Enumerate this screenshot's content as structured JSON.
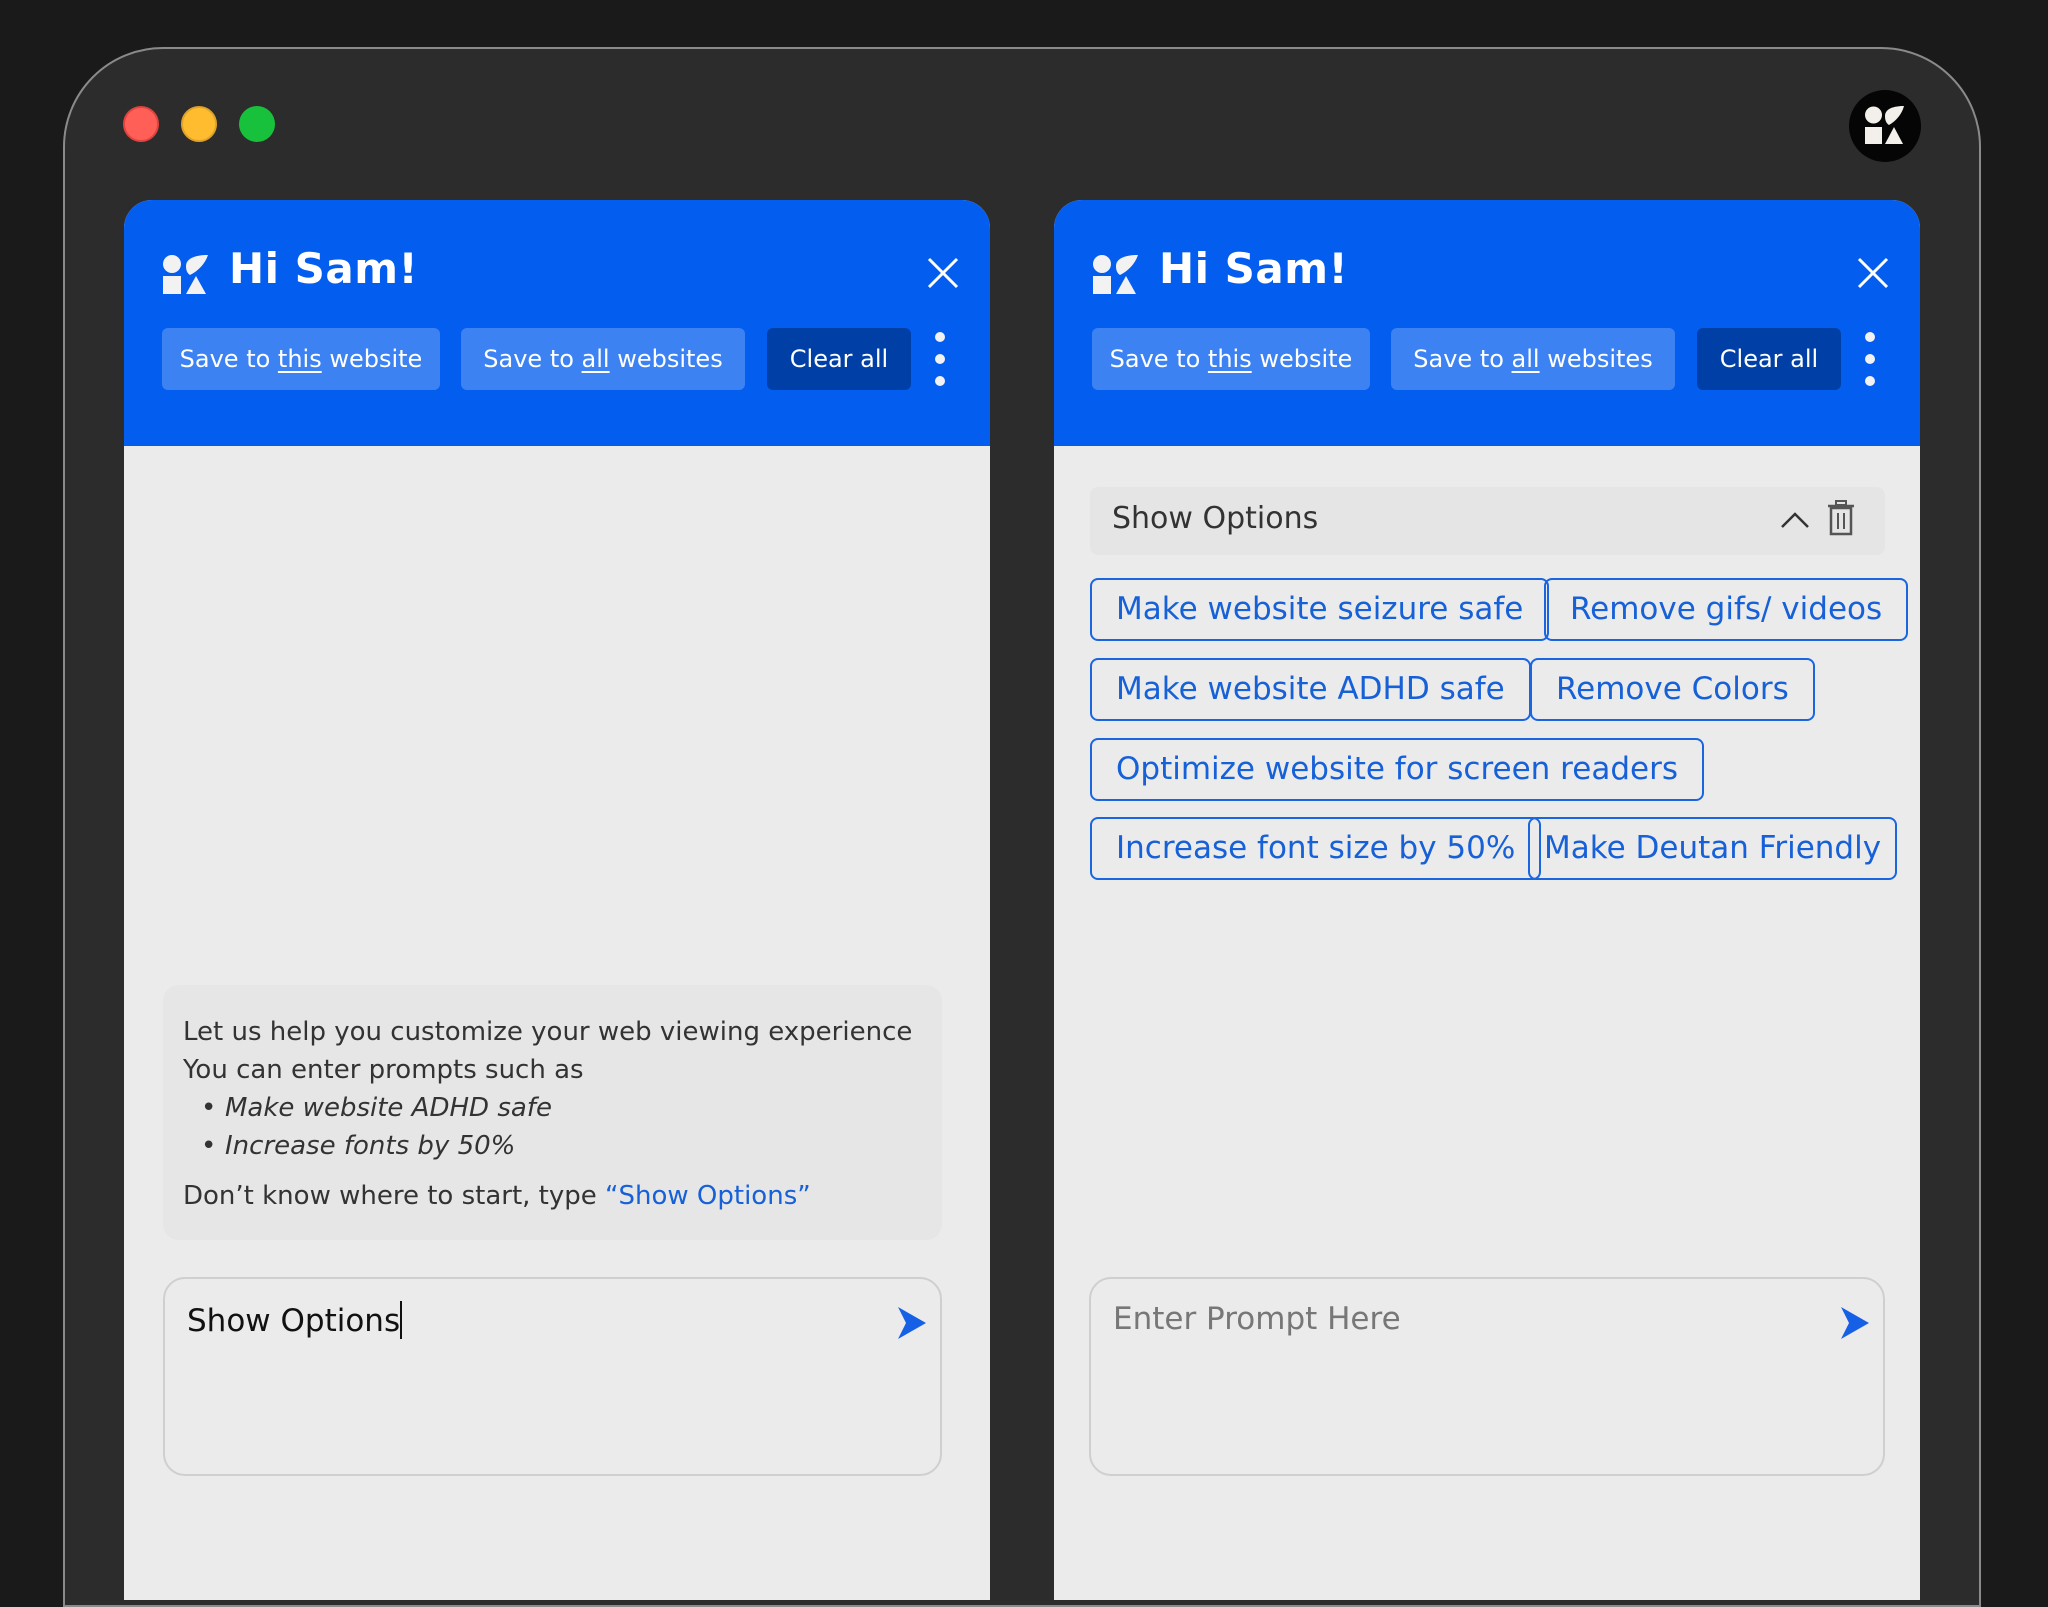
{
  "window": {
    "traffic_lights": [
      "close",
      "minimize",
      "maximize"
    ],
    "brand_icon": "shapes-logo-icon"
  },
  "colors": {
    "header_blue": "#035ef0",
    "button_light": "#3d82f2",
    "button_dark": "#0040a6",
    "link_blue": "#1660d8",
    "panel_bg": "#ebebeb"
  },
  "panels": [
    {
      "header": {
        "title": "Hi Sam!",
        "save_this": {
          "prefix": "Save to ",
          "underlined": "this",
          "suffix": " website"
        },
        "save_all": {
          "prefix": "Save to ",
          "underlined": "all",
          "suffix": " websites"
        },
        "clear_all": "Clear all"
      },
      "help": {
        "line1": "Let us help you customize your web viewing experience",
        "line2": "You can enter prompts such as",
        "examples": [
          "Make website ADHD safe",
          "Increase fonts by 50%"
        ],
        "hint_prefix": "Don’t know where to start, type ",
        "hint_link": "“Show Options”"
      },
      "prompt": {
        "value": "Show Options",
        "placeholder": "Enter Prompt Here"
      }
    },
    {
      "header": {
        "title": "Hi Sam!",
        "save_this": {
          "prefix": "Save to ",
          "underlined": "this",
          "suffix": " website"
        },
        "save_all": {
          "prefix": "Save to ",
          "underlined": "all",
          "suffix": " websites"
        },
        "clear_all": "Clear all"
      },
      "options": {
        "title": "Show Options",
        "chips": [
          "Make website seizure safe",
          "Remove gifs/ videos",
          "Make website ADHD safe",
          "Remove Colors",
          "Optimize website for screen readers",
          "Increase font size by 50%",
          "Make Deutan Friendly"
        ]
      },
      "prompt": {
        "value": "",
        "placeholder": "Enter Prompt Here"
      }
    }
  ]
}
